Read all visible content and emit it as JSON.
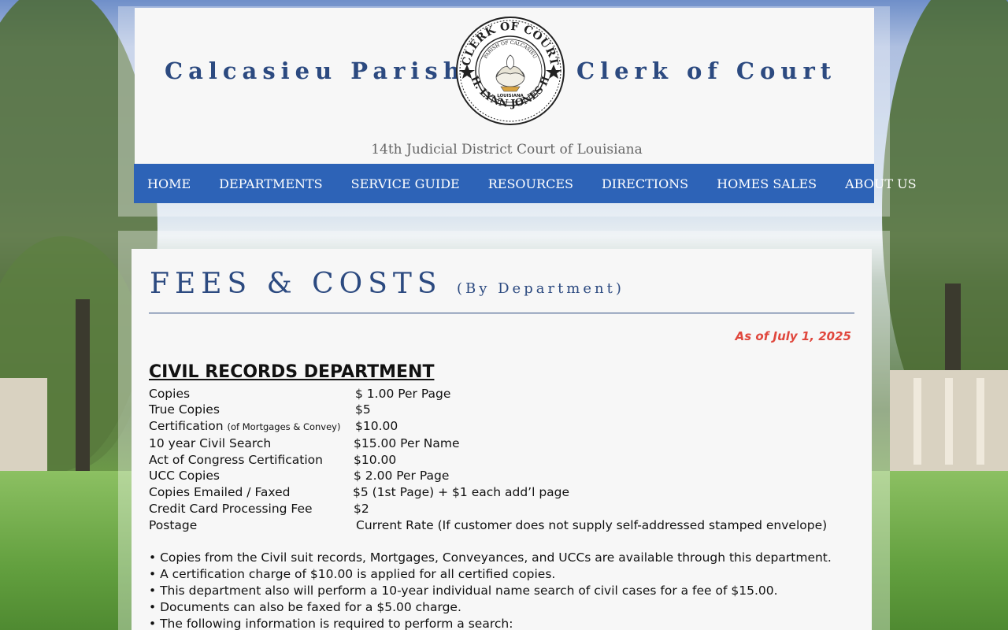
{
  "header": {
    "title_left": "Calcasieu Parish",
    "title_right": "Clerk of Court",
    "seal_top_text": "CLERK OF COURT",
    "seal_inner_top": "PARISH OF CALCASIEU",
    "seal_inner_bottom": "LOUISIANA",
    "seal_bottom_text": "H. LYNN JONES II",
    "subtitle": "14th Judicial District Court of Louisiana"
  },
  "nav": {
    "items": [
      "HOME",
      "DEPARTMENTS",
      "SERVICE GUIDE",
      "RESOURCES",
      "DIRECTIONS",
      "HOMES SALES",
      "ABOUT US"
    ]
  },
  "page": {
    "title": "FEES & COSTS",
    "title_sub": "(By Department)",
    "as_of": "As of July 1, 2025"
  },
  "civil": {
    "title": "CIVIL RECORDS DEPARTMENT",
    "fees": [
      {
        "label": "Copies",
        "note": "",
        "value": "$ 1.00 Per Page"
      },
      {
        "label": "True Copies",
        "note": "",
        "value": "$5"
      },
      {
        "label": "Certification",
        "note": "(of Mortgages & Convey)",
        "value": "$10.00"
      },
      {
        "label": "10 year Civil Search",
        "note": "",
        "value": "$15.00 Per Name"
      },
      {
        "label": "Act of Congress Certification",
        "note": "",
        "value": "$10.00"
      },
      {
        "label": "UCC Copies",
        "note": "",
        "value": "$ 2.00 Per Page"
      },
      {
        "label": "Copies Emailed / Faxed",
        "note": "",
        "value": "$5 (1st Page) + $1 each add’l page"
      },
      {
        "label": "Credit Card Processing Fee",
        "note": "",
        "value": "$2"
      },
      {
        "label": "Postage",
        "note": "",
        "value": "Current Rate (If customer does not supply self-addressed stamped envelope)"
      }
    ],
    "bullets": [
      "• Copies from the Civil suit records, Mortgages, Conveyances, and UCCs are available through this department.",
      "• A certification charge of $10.00 is applied for all certified copies.",
      "• This department also will perform a 10-year individual name search of civil cases for a fee of $15.00.",
      "• Documents can also be faxed for a $5.00 charge.",
      "• The following information is required to perform a search:"
    ]
  },
  "colors": {
    "brand_blue": "#2c4a80",
    "nav_blue": "#2d63b7",
    "as_of_red": "#e0473d"
  }
}
